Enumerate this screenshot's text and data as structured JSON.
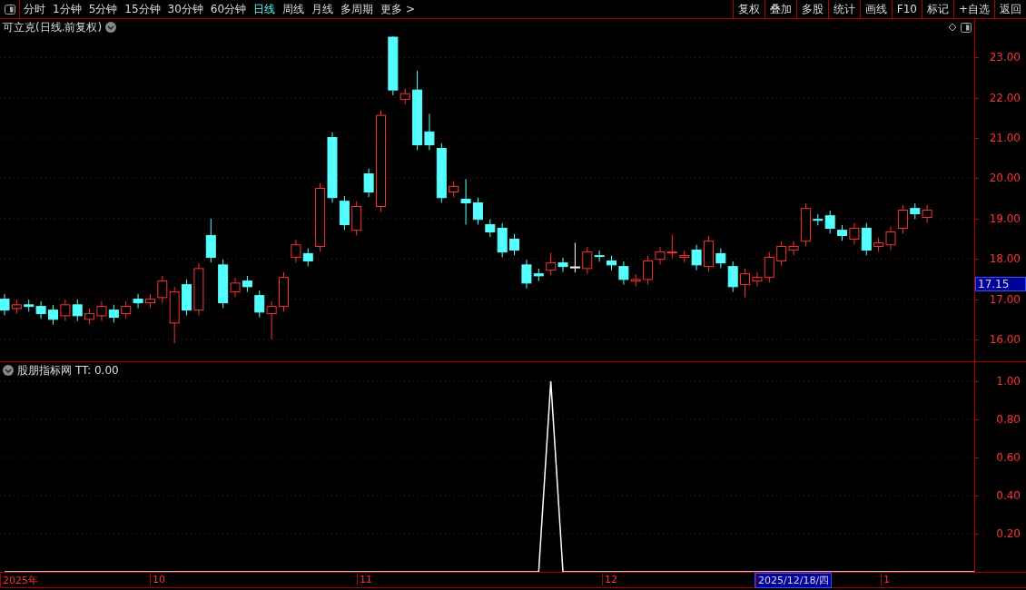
{
  "toolbar": {
    "periods": [
      {
        "label": "分时",
        "selected": false
      },
      {
        "label": "1分钟",
        "selected": false
      },
      {
        "label": "5分钟",
        "selected": false
      },
      {
        "label": "15分钟",
        "selected": false
      },
      {
        "label": "30分钟",
        "selected": false
      },
      {
        "label": "60分钟",
        "selected": false
      },
      {
        "label": "日线",
        "selected": true
      },
      {
        "label": "周线",
        "selected": false
      },
      {
        "label": "月线",
        "selected": false
      },
      {
        "label": "多周期",
        "selected": false
      },
      {
        "label": "更多 >",
        "selected": false
      }
    ],
    "actions": [
      "复权",
      "叠加",
      "多股",
      "统计",
      "画线",
      "F10",
      "标记",
      "+自选",
      "返回"
    ]
  },
  "main_panel": {
    "title": "可立克(日线.前复权)",
    "price_tag": "17.15",
    "chart_data": {
      "type": "candlestick",
      "ylim": [
        15.46,
        23.95
      ],
      "grid": true,
      "yticks": [
        {
          "value": 23,
          "label": "23.00"
        },
        {
          "value": 22,
          "label": "22.00"
        },
        {
          "value": 21,
          "label": "21.00"
        },
        {
          "value": 20,
          "label": "20.00"
        },
        {
          "value": 19,
          "label": "19.00"
        },
        {
          "value": 18,
          "label": "18.00"
        },
        {
          "value": 17,
          "label": "17.00"
        },
        {
          "value": 16,
          "label": "16.00"
        }
      ],
      "ohlc": [
        [
          17.0,
          17.13,
          16.6,
          16.73
        ],
        [
          16.77,
          16.99,
          16.64,
          16.86
        ],
        [
          16.86,
          16.99,
          16.69,
          16.82
        ],
        [
          16.82,
          16.95,
          16.51,
          16.64
        ],
        [
          16.73,
          16.86,
          16.37,
          16.5
        ],
        [
          16.59,
          16.99,
          16.46,
          16.86
        ],
        [
          16.86,
          16.99,
          16.46,
          16.59
        ],
        [
          16.5,
          16.77,
          16.37,
          16.64
        ],
        [
          16.59,
          16.95,
          16.46,
          16.82
        ],
        [
          16.73,
          16.86,
          16.42,
          16.55
        ],
        [
          16.64,
          16.95,
          16.51,
          16.82
        ],
        [
          17.0,
          17.13,
          16.78,
          16.91
        ],
        [
          16.91,
          17.13,
          16.78,
          17.0
        ],
        [
          17.04,
          17.58,
          16.91,
          17.45
        ],
        [
          16.41,
          17.31,
          15.91,
          17.18
        ],
        [
          17.36,
          17.49,
          16.6,
          16.73
        ],
        [
          16.73,
          17.89,
          16.6,
          17.76
        ],
        [
          18.58,
          19.0,
          17.91,
          18.04
        ],
        [
          17.85,
          17.98,
          16.78,
          16.91
        ],
        [
          17.18,
          17.53,
          17.05,
          17.4
        ],
        [
          17.45,
          17.58,
          17.18,
          17.31
        ],
        [
          17.09,
          17.22,
          16.55,
          16.68
        ],
        [
          16.64,
          16.95,
          16.0,
          16.82
        ],
        [
          16.82,
          17.67,
          16.69,
          17.54
        ],
        [
          18.04,
          18.48,
          17.91,
          18.35
        ],
        [
          18.13,
          18.26,
          17.82,
          17.95
        ],
        [
          18.31,
          19.88,
          18.18,
          19.75
        ],
        [
          21.01,
          21.14,
          19.39,
          19.52
        ],
        [
          19.43,
          19.56,
          18.72,
          18.85
        ],
        [
          18.71,
          19.43,
          18.58,
          19.3
        ],
        [
          20.11,
          20.24,
          19.53,
          19.66
        ],
        [
          19.3,
          21.69,
          19.17,
          21.56
        ],
        [
          23.5,
          23.52,
          22.06,
          22.19
        ],
        [
          21.96,
          22.23,
          21.83,
          22.1
        ],
        [
          22.19,
          22.67,
          20.7,
          20.83
        ],
        [
          21.15,
          21.6,
          20.7,
          20.83
        ],
        [
          20.74,
          20.87,
          19.39,
          19.52
        ],
        [
          19.66,
          19.93,
          19.53,
          19.8
        ],
        [
          19.48,
          19.98,
          18.85,
          19.39
        ],
        [
          19.39,
          19.52,
          18.85,
          18.98
        ],
        [
          18.85,
          18.98,
          18.54,
          18.67
        ],
        [
          18.76,
          18.89,
          18.04,
          18.17
        ],
        [
          18.49,
          18.62,
          18.09,
          18.22
        ],
        [
          17.85,
          17.98,
          17.27,
          17.4
        ],
        [
          17.63,
          17.76,
          17.45,
          17.58
        ],
        [
          17.72,
          18.15,
          17.59,
          17.9
        ],
        [
          17.9,
          18.03,
          17.68,
          17.81
        ],
        [
          17.8,
          18.4,
          17.66,
          17.8
        ],
        [
          17.76,
          18.3,
          17.63,
          18.17
        ],
        [
          18.08,
          18.21,
          17.93,
          18.06
        ],
        [
          17.95,
          18.08,
          17.72,
          17.85
        ],
        [
          17.81,
          17.94,
          17.36,
          17.49
        ],
        [
          17.45,
          17.62,
          17.32,
          17.49
        ],
        [
          17.49,
          18.08,
          17.36,
          17.95
        ],
        [
          17.99,
          18.3,
          17.86,
          18.17
        ],
        [
          18.15,
          18.6,
          18.02,
          18.17
        ],
        [
          18.04,
          18.21,
          17.91,
          18.08
        ],
        [
          18.22,
          18.35,
          17.72,
          17.85
        ],
        [
          17.81,
          18.57,
          17.68,
          18.44
        ],
        [
          18.13,
          18.26,
          17.77,
          17.9
        ],
        [
          17.81,
          17.94,
          17.18,
          17.31
        ],
        [
          17.36,
          17.76,
          17.05,
          17.63
        ],
        [
          17.45,
          17.67,
          17.32,
          17.54
        ],
        [
          17.54,
          18.17,
          17.41,
          18.04
        ],
        [
          17.95,
          18.44,
          17.82,
          18.31
        ],
        [
          18.22,
          18.44,
          18.09,
          18.31
        ],
        [
          18.44,
          19.38,
          18.31,
          19.25
        ],
        [
          18.98,
          19.11,
          18.83,
          18.96
        ],
        [
          19.07,
          19.2,
          18.63,
          18.76
        ],
        [
          18.71,
          18.84,
          18.45,
          18.58
        ],
        [
          18.49,
          18.89,
          18.36,
          18.76
        ],
        [
          18.76,
          18.89,
          18.09,
          18.22
        ],
        [
          18.31,
          18.53,
          18.18,
          18.4
        ],
        [
          18.35,
          18.8,
          18.22,
          18.67
        ],
        [
          18.76,
          19.34,
          18.63,
          19.21
        ],
        [
          19.25,
          19.38,
          18.99,
          19.12
        ],
        [
          19.03,
          19.34,
          18.9,
          19.21
        ]
      ]
    }
  },
  "indicator_panel": {
    "name": "股朋指标网",
    "reading": "TT: 0.00",
    "chart_data": {
      "type": "line",
      "ylim": [
        0,
        1.1
      ],
      "grid": true,
      "yticks": [
        {
          "value": 0.2,
          "label": "0.20"
        },
        {
          "value": 0.4,
          "label": "0.40"
        },
        {
          "value": 0.6,
          "label": "0.60"
        },
        {
          "value": 0.8,
          "label": "0.80"
        },
        {
          "value": 1,
          "label": "1.00"
        }
      ],
      "values": [
        0,
        0,
        0,
        0,
        0,
        0,
        0,
        0,
        0,
        0,
        0,
        0,
        0,
        0,
        0,
        0,
        0,
        0,
        0,
        0,
        0,
        0,
        0,
        0,
        0,
        0,
        0,
        0,
        0,
        0,
        0,
        0,
        0,
        0,
        0,
        0,
        0,
        0,
        0,
        0,
        0,
        0,
        0,
        0,
        0,
        1,
        0,
        0,
        0,
        0,
        0,
        0,
        0,
        0,
        0,
        0,
        0,
        0,
        0,
        0,
        0,
        0,
        0,
        0,
        0,
        0,
        0,
        0,
        0,
        0,
        0,
        0,
        0,
        0,
        0,
        0,
        0,
        0,
        0,
        0,
        0
      ]
    }
  },
  "date_axis": [
    {
      "label": "2025年",
      "selected": false
    },
    {
      "label": "10",
      "selected": false
    },
    {
      "label": "11",
      "selected": false
    },
    {
      "label": "12",
      "selected": false
    },
    {
      "label": "2025/12/18/四",
      "selected": true
    },
    {
      "label": "1",
      "selected": false
    }
  ]
}
